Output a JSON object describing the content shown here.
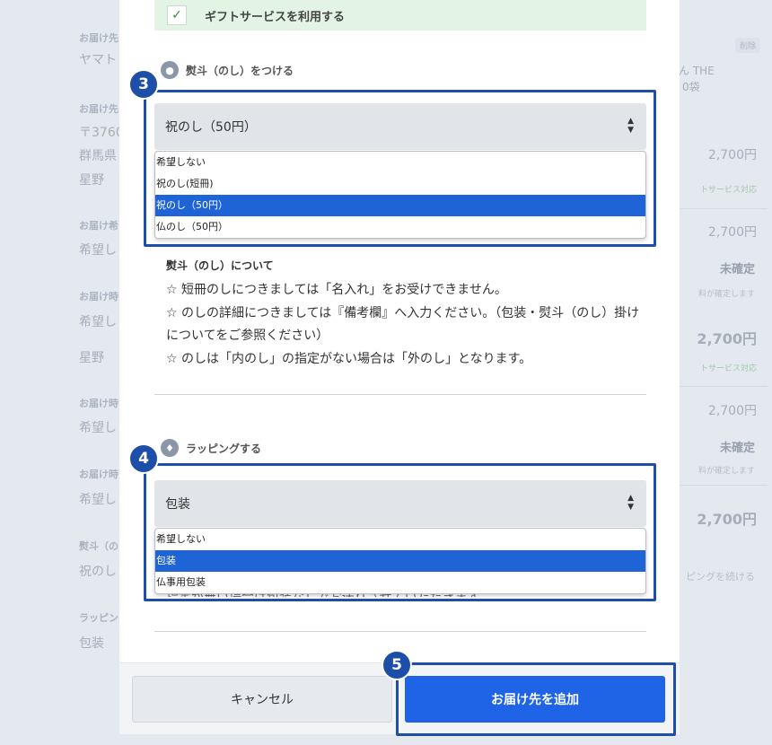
{
  "background": {
    "left_labels": [
      "お届け先",
      "お届け先",
      "お届け希",
      "お届け時",
      "お届け時",
      "お届け時",
      "熨斗（の",
      "ラッピン"
    ],
    "left_values": [
      "ヤマト",
      "〒3760",
      "群馬県",
      "星野",
      "希望し",
      "希望し",
      "星野",
      "希望し",
      "希望し",
      "祝のし",
      "包装"
    ],
    "right": {
      "delete_label": "削除",
      "product_line1": "ん THE",
      "product_line2": "0袋",
      "price1": "2,700円",
      "gift_service1": "トサービス対応",
      "price2": "2,700円",
      "undetermined1": "未確定",
      "note1": "料が確定します",
      "price3": "2,700円",
      "gift_service2": "トサービス対応",
      "price4": "2,700円",
      "undetermined2": "未確定",
      "note2": "料が確定します",
      "total": "2,700円",
      "continue_link": "ピングを続ける"
    }
  },
  "modal": {
    "gift_service": {
      "label": "ギフトサービスを利用する",
      "checked": true
    },
    "noshi": {
      "step": "3",
      "heading": "熨斗（のし）をつける",
      "selected": "祝のし（50円）",
      "options": [
        "希望しない",
        "祝のし(短冊)",
        "祝のし（50円）",
        "仏のし（50円）"
      ],
      "selected_index": 2,
      "notes_title": "熨斗（のし）について",
      "notes": [
        "☆ 短冊のしにつきましては「名入れ」をお受けできません。",
        "☆ のしの詳細につきましては『備考欄』へ入力ください。（包装・熨斗（のし）掛けについてをご参照ください）",
        "☆ のしは「内のし」の指定がない場合は「外のし」となります。"
      ]
    },
    "wrapping": {
      "step": "4",
      "heading": "ラッピングする",
      "selected": "包装",
      "options": [
        "希望しない",
        "包装",
        "仏事用包装"
      ],
      "selected_index": 1,
      "hidden_note": "指定が無い場合は包装なしでお送りさせていただきます。"
    },
    "footer": {
      "step": "5",
      "cancel_label": "キャンセル",
      "submit_label": "お届け先を追加"
    }
  },
  "colors": {
    "accent_blue": "#1f63e6",
    "highlight_border": "#1e4fa8",
    "option_selected": "#1f64d6",
    "gift_bar_bg": "#e3f4e5"
  }
}
